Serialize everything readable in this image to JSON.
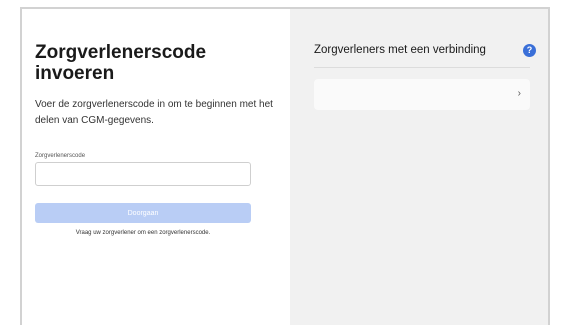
{
  "left_panel": {
    "title": "Zorgverlenerscode invoeren",
    "description": "Voer de zorgverlenerscode in om te beginnen met het delen van CGM-gegevens.",
    "field_label": "Zorgverlenerscode",
    "field_value": "",
    "field_placeholder": "",
    "button_label": "Doorgaan",
    "hint": "Vraag uw zorgverlener om een zorgverlenerscode."
  },
  "right_panel": {
    "title": "Zorgverleners met een verbinding",
    "help_icon": "question-circle-icon",
    "card_icon": "chevron-right-icon"
  },
  "colors": {
    "button_disabled": "#b9cdf5",
    "help_accent": "#3a6fd8",
    "right_background": "#f1f1f1"
  }
}
